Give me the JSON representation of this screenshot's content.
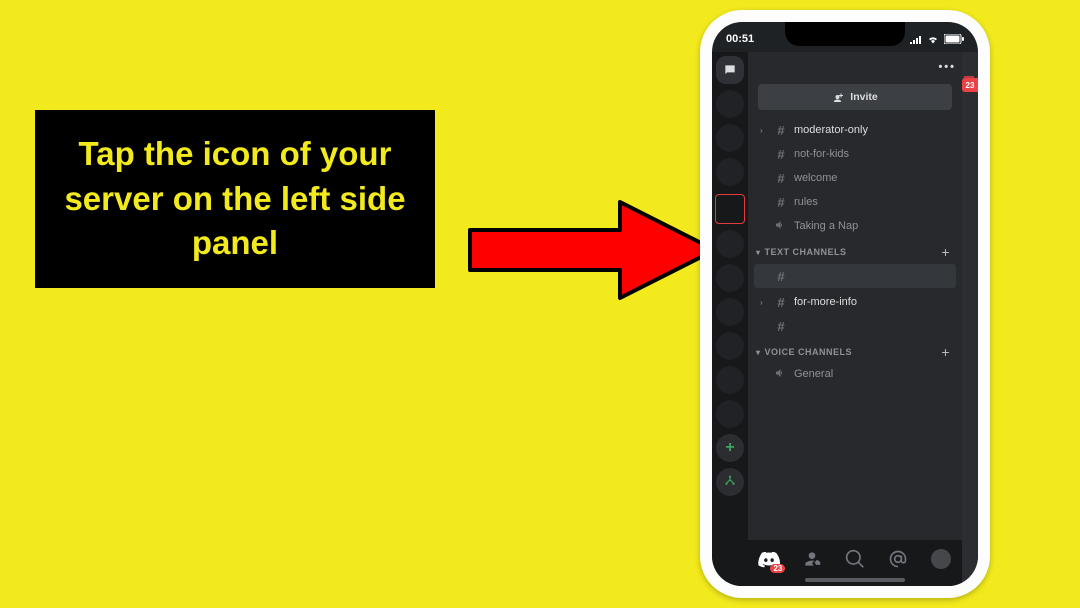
{
  "instruction": "Tap the icon of your server on the left side panel",
  "status": {
    "time": "00:51",
    "mentions": "23",
    "tab_badge": "23"
  },
  "panel": {
    "menu_icon": "•••",
    "invite": "Invite",
    "categories": {
      "text": "TEXT CHANNELS",
      "voice": "VOICE CHANNELS"
    },
    "top_channels": [
      {
        "name": "moderator-only",
        "bright": true,
        "caret": true
      },
      {
        "name": "not-for-kids"
      },
      {
        "name": "welcome"
      },
      {
        "name": "rules"
      },
      {
        "name": "Taking a Nap",
        "voice": true
      }
    ],
    "text_channels": [
      {
        "name": "",
        "blank": true
      },
      {
        "name": "for-more-info",
        "bright": true,
        "caret": true
      },
      {
        "name": "",
        "blank_icon": true
      }
    ],
    "voice_channels": [
      {
        "name": "General"
      }
    ]
  }
}
